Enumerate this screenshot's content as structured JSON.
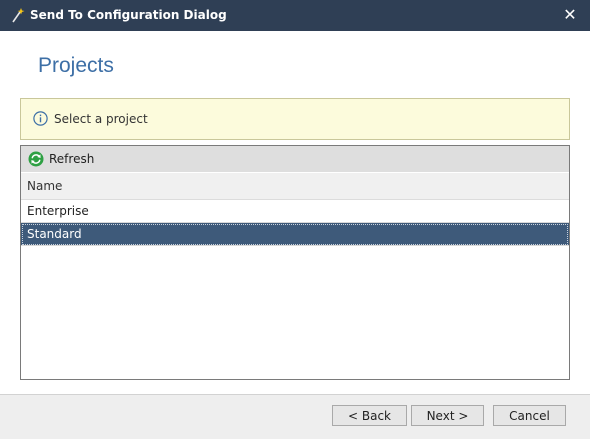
{
  "window": {
    "title": "Send To Configuration Dialog",
    "close_glyph": "✕"
  },
  "page": {
    "title": "Projects"
  },
  "info": {
    "message": "Select a project"
  },
  "toolbar": {
    "refresh_label": "Refresh"
  },
  "table": {
    "column_header": "Name",
    "rows": [
      {
        "name": "Enterprise",
        "selected": false
      },
      {
        "name": "Standard",
        "selected": true
      }
    ]
  },
  "footer": {
    "back_label": "< Back",
    "next_label": "Next >",
    "cancel_label": "Cancel"
  },
  "colors": {
    "titlebar": "#2f3f55",
    "accent": "#3d6fa6",
    "selection": "#3e5a7a",
    "info_background": "#fcfbdc"
  },
  "icons": {
    "app": "magic-wand-icon",
    "info": "info-circle-icon",
    "refresh": "refresh-icon",
    "close": "close-icon"
  }
}
